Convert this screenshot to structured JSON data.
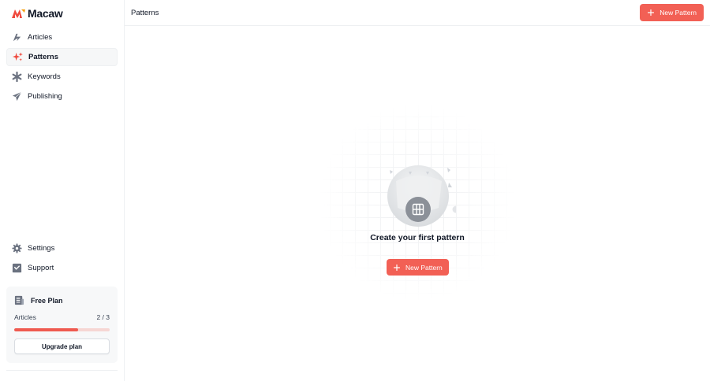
{
  "app": {
    "name": "Macaw",
    "brand_color": "#f26055"
  },
  "sidebar": {
    "items": [
      {
        "label": "Articles",
        "icon": "bolt-icon",
        "active": false
      },
      {
        "label": "Patterns",
        "icon": "sparkles-icon",
        "active": true
      },
      {
        "label": "Keywords",
        "icon": "asterisk-icon",
        "active": false
      },
      {
        "label": "Publishing",
        "icon": "paper-plane-icon",
        "active": false
      }
    ],
    "bottom_items": [
      {
        "label": "Settings",
        "icon": "gear-icon"
      },
      {
        "label": "Support",
        "icon": "support-icon"
      }
    ],
    "plan": {
      "title": "Free Plan",
      "usage_label": "Articles",
      "usage_count": "2 / 3",
      "usage_fraction": 0.67,
      "upgrade_label": "Upgrade plan"
    }
  },
  "header": {
    "title": "Patterns",
    "new_button_label": "New Pattern"
  },
  "empty_state": {
    "title": "Create your first pattern",
    "button_label": "New Pattern",
    "icon": "pattern-grid-icon"
  }
}
